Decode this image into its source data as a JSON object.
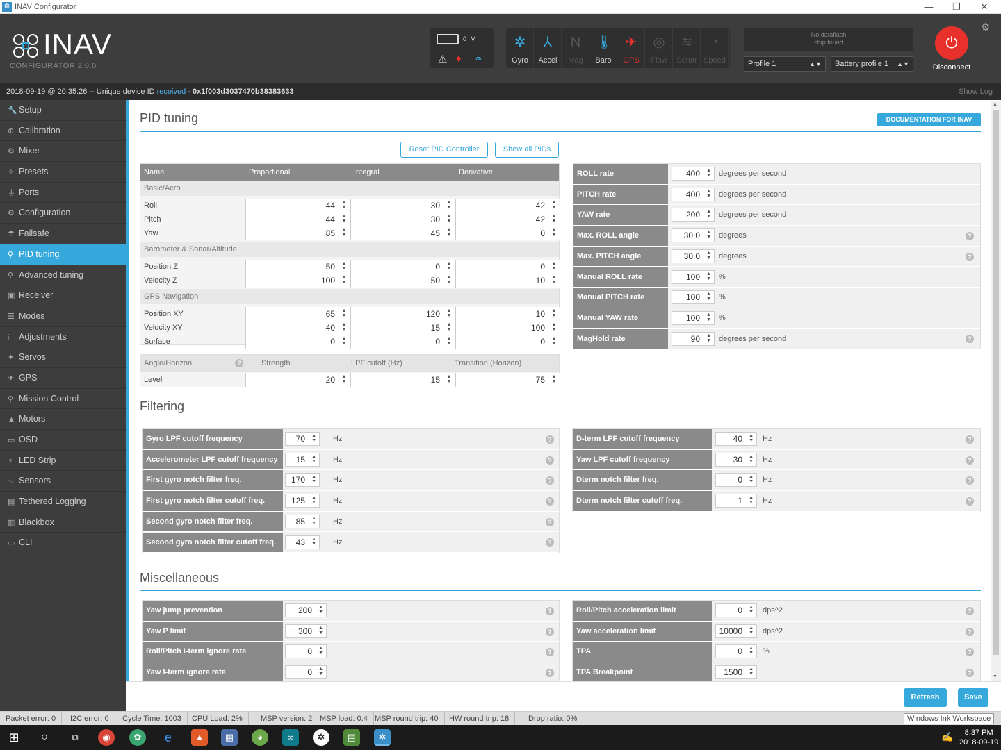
{
  "window": {
    "title": "INAV Configurator",
    "minimize": "—",
    "restore": "❐",
    "close": "✕"
  },
  "header": {
    "logo_text": "INAV",
    "logo_sub": "CONFIGURATOR   2.0.0",
    "battery_voltage": "0 V",
    "sensors": [
      {
        "label": "Gyro",
        "icon": "gyro-icon",
        "glyph": "✲",
        "state": "on"
      },
      {
        "label": "Accel",
        "icon": "accel-icon",
        "glyph": "⅄",
        "state": "on"
      },
      {
        "label": "Mag",
        "icon": "compass-icon",
        "glyph": "N",
        "state": "off"
      },
      {
        "label": "Baro",
        "icon": "thermometer-icon",
        "glyph": "🌡",
        "state": "on"
      },
      {
        "label": "GPS",
        "icon": "satellite-icon",
        "glyph": "✈",
        "state": "error"
      },
      {
        "label": "Flow",
        "icon": "flow-icon",
        "glyph": "◎",
        "state": "off"
      },
      {
        "label": "Sonar",
        "icon": "sonar-icon",
        "glyph": "≋",
        "state": "off"
      },
      {
        "label": "Speed",
        "icon": "speedometer-icon",
        "glyph": "◔",
        "state": "off"
      }
    ],
    "dataflash_line1": "No dataflash",
    "dataflash_line2": "chip found",
    "profile": "Profile 1",
    "battery_profile": "Battery profile 1",
    "disconnect": "Disconnect"
  },
  "statusline": {
    "prefix": "2018-09-19 @ 20:35:26 -- Unique device ID ",
    "received": "received",
    "sep": " - ",
    "device_id": "0x1f003d3037470b38383633",
    "show_log": "Show Log"
  },
  "sidebar": {
    "items": [
      {
        "label": "Setup",
        "icon": "wrench-icon",
        "glyph": "🔧"
      },
      {
        "label": "Calibration",
        "icon": "crosshair-icon",
        "glyph": "⊕"
      },
      {
        "label": "Mixer",
        "icon": "mixer-icon",
        "glyph": "⚙"
      },
      {
        "label": "Presets",
        "icon": "presets-icon",
        "glyph": "✧"
      },
      {
        "label": "Ports",
        "icon": "plug-icon",
        "glyph": "⏚"
      },
      {
        "label": "Configuration",
        "icon": "gear-icon",
        "glyph": "⚙"
      },
      {
        "label": "Failsafe",
        "icon": "parachute-icon",
        "glyph": "☂"
      },
      {
        "label": "PID tuning",
        "icon": "pid-icon",
        "glyph": "⚲",
        "active": true
      },
      {
        "label": "Advanced tuning",
        "icon": "advanced-tuning-icon",
        "glyph": "⚲"
      },
      {
        "label": "Receiver",
        "icon": "receiver-icon",
        "glyph": "▣"
      },
      {
        "label": "Modes",
        "icon": "modes-icon",
        "glyph": "☰"
      },
      {
        "label": "Adjustments",
        "icon": "sliders-icon",
        "glyph": "⫶"
      },
      {
        "label": "Servos",
        "icon": "servo-icon",
        "glyph": "✦"
      },
      {
        "label": "GPS",
        "icon": "gps-icon",
        "glyph": "✈"
      },
      {
        "label": "Mission Control",
        "icon": "map-pin-icon",
        "glyph": "⚲"
      },
      {
        "label": "Motors",
        "icon": "motor-icon",
        "glyph": "▲"
      },
      {
        "label": "OSD",
        "icon": "osd-icon",
        "glyph": "▭"
      },
      {
        "label": "LED Strip",
        "icon": "led-icon",
        "glyph": "♆"
      },
      {
        "label": "Sensors",
        "icon": "sensors-icon",
        "glyph": "⏦"
      },
      {
        "label": "Tethered Logging",
        "icon": "log-icon",
        "glyph": "▤"
      },
      {
        "label": "Blackbox",
        "icon": "blackbox-icon",
        "glyph": "▥"
      },
      {
        "label": "CLI",
        "icon": "terminal-icon",
        "glyph": "▭"
      }
    ]
  },
  "pid": {
    "title": "PID tuning",
    "doc_button": "DOCUMENTATION FOR INAV",
    "reset_button": "Reset PID Controller",
    "show_all_button": "Show all PIDs",
    "columns": [
      "Name",
      "Proportional",
      "Integral",
      "Derivative"
    ],
    "groups": [
      {
        "name": "Basic/Acro",
        "rows": [
          {
            "name": "Roll",
            "p": "44",
            "i": "30",
            "d": "42"
          },
          {
            "name": "Pitch",
            "p": "44",
            "i": "30",
            "d": "42"
          },
          {
            "name": "Yaw",
            "p": "85",
            "i": "45",
            "d": "0"
          }
        ]
      },
      {
        "name": "Barometer & Sonar/Altitude",
        "rows": [
          {
            "name": "Position Z",
            "p": "50",
            "i": "0",
            "d": "0"
          },
          {
            "name": "Velocity Z",
            "p": "100",
            "i": "50",
            "d": "10"
          }
        ]
      },
      {
        "name": "GPS Navigation",
        "rows": [
          {
            "name": "Position XY",
            "p": "65",
            "i": "120",
            "d": "10"
          },
          {
            "name": "Velocity XY",
            "p": "40",
            "i": "15",
            "d": "100"
          },
          {
            "name": "Surface",
            "p": "0",
            "i": "0",
            "d": "0"
          }
        ]
      }
    ],
    "angle": {
      "head": [
        "Angle/Horizon",
        "Strength",
        "LPF cutoff (Hz)",
        "Transition (Horizon)"
      ],
      "row": {
        "name": "Level",
        "strength": "20",
        "lpf": "15",
        "transition": "75"
      }
    },
    "rates": [
      {
        "label": "ROLL rate",
        "value": "400",
        "unit": "degrees per second",
        "help": false
      },
      {
        "label": "PITCH rate",
        "value": "400",
        "unit": "degrees per second",
        "help": false
      },
      {
        "label": "YAW rate",
        "value": "200",
        "unit": "degrees per second",
        "help": false
      },
      {
        "label": "Max. ROLL angle",
        "value": "30.0",
        "unit": "degrees",
        "help": true
      },
      {
        "label": "Max. PITCH angle",
        "value": "30.0",
        "unit": "degrees",
        "help": true
      },
      {
        "label": "Manual ROLL rate",
        "value": "100",
        "unit": "%",
        "help": false
      },
      {
        "label": "Manual PITCH rate",
        "value": "100",
        "unit": "%",
        "help": false
      },
      {
        "label": "Manual YAW rate",
        "value": "100",
        "unit": "%",
        "help": false
      },
      {
        "label": "MagHold rate",
        "value": "90",
        "unit": "degrees per second",
        "help": true
      }
    ]
  },
  "filtering": {
    "title": "Filtering",
    "left": [
      {
        "label": "Gyro LPF cutoff frequency",
        "value": "70",
        "unit": "Hz"
      },
      {
        "label": "Accelerometer LPF cutoff frequency",
        "value": "15",
        "unit": "Hz"
      },
      {
        "label": "First gyro notch filter freq.",
        "value": "170",
        "unit": "Hz"
      },
      {
        "label": "First gyro notch filter cutoff freq.",
        "value": "125",
        "unit": "Hz"
      },
      {
        "label": "Second gyro notch filter freq.",
        "value": "85",
        "unit": "Hz"
      },
      {
        "label": "Second gyro notch filter cutoff freq.",
        "value": "43",
        "unit": "Hz"
      }
    ],
    "right": [
      {
        "label": "D-term LPF cutoff frequency",
        "value": "40",
        "unit": "Hz"
      },
      {
        "label": "Yaw LPF cutoff frequency",
        "value": "30",
        "unit": "Hz"
      },
      {
        "label": "Dterm notch filter freq.",
        "value": "0",
        "unit": "Hz"
      },
      {
        "label": "Dterm notch filter cutoff freq.",
        "value": "1",
        "unit": "Hz"
      }
    ]
  },
  "misc": {
    "title": "Miscellaneous",
    "left": [
      {
        "label": "Yaw jump prevention",
        "value": "200",
        "unit": ""
      },
      {
        "label": "Yaw P limit",
        "value": "300",
        "unit": ""
      },
      {
        "label": "Roll/Pitch I-term ignore rate",
        "value": "0",
        "unit": ""
      },
      {
        "label": "Yaw I-term ignore rate",
        "value": "0",
        "unit": ""
      }
    ],
    "right": [
      {
        "label": "Roll/Pitch acceleration limit",
        "value": "0",
        "unit": "dps^2"
      },
      {
        "label": "Yaw acceleration limit",
        "value": "10000",
        "unit": "dps^2"
      },
      {
        "label": "TPA",
        "value": "0",
        "unit": "%"
      },
      {
        "label": "TPA Breakpoint",
        "value": "1500",
        "unit": ""
      }
    ]
  },
  "actions": {
    "refresh": "Refresh",
    "save": "Save"
  },
  "footer": {
    "items": [
      "Packet error: 0",
      "I2C error: 0",
      "Cycle Time: 1003",
      "CPU Load: 2%",
      "MSP version: 2",
      "MSP load: 0.4",
      "MSP round trip: 40",
      "HW round trip: 18",
      "Drop ratio: 0%"
    ],
    "tooltip": "Windows Ink Workspace"
  },
  "taskbar": {
    "time": "8:37 PM",
    "date": "2018-09-19"
  },
  "colors": {
    "accent": "#37a8db",
    "header": "#3d3d3d",
    "sidebar": "#3d3d3d",
    "disconnect": "#e8312b",
    "sensor_on": "#37a8db",
    "sensor_off": "#555555",
    "sensor_error": "#e8312b"
  }
}
